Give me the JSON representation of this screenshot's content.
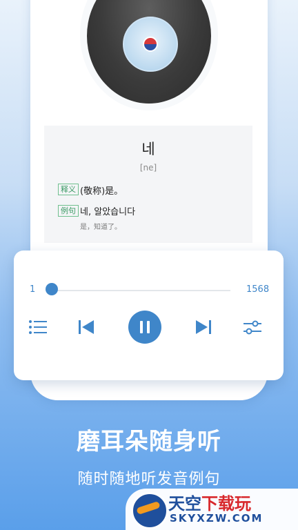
{
  "word_card": {
    "word": "네",
    "phonetic": "[ne]",
    "definition_tag": "释义",
    "definition": "(敬称)是。",
    "example_tag": "例句",
    "example": "네, 알았습니다",
    "example_translation": "是，知道了。"
  },
  "player": {
    "current_index": "1",
    "total": "1568",
    "progress": 0.0
  },
  "promo": {
    "headline": "磨耳朵随身听",
    "subline": "随时随地听发音例句"
  },
  "watermark": {
    "title_part1": "天空",
    "title_part2": "下载玩",
    "url": "SKYXZW.COM"
  },
  "colors": {
    "accent": "#3f86c9",
    "tag_green": "#3a9a64"
  },
  "icons": [
    "playlist-icon",
    "skip-previous-icon",
    "pause-icon",
    "skip-next-icon",
    "equalizer-settings-icon"
  ]
}
